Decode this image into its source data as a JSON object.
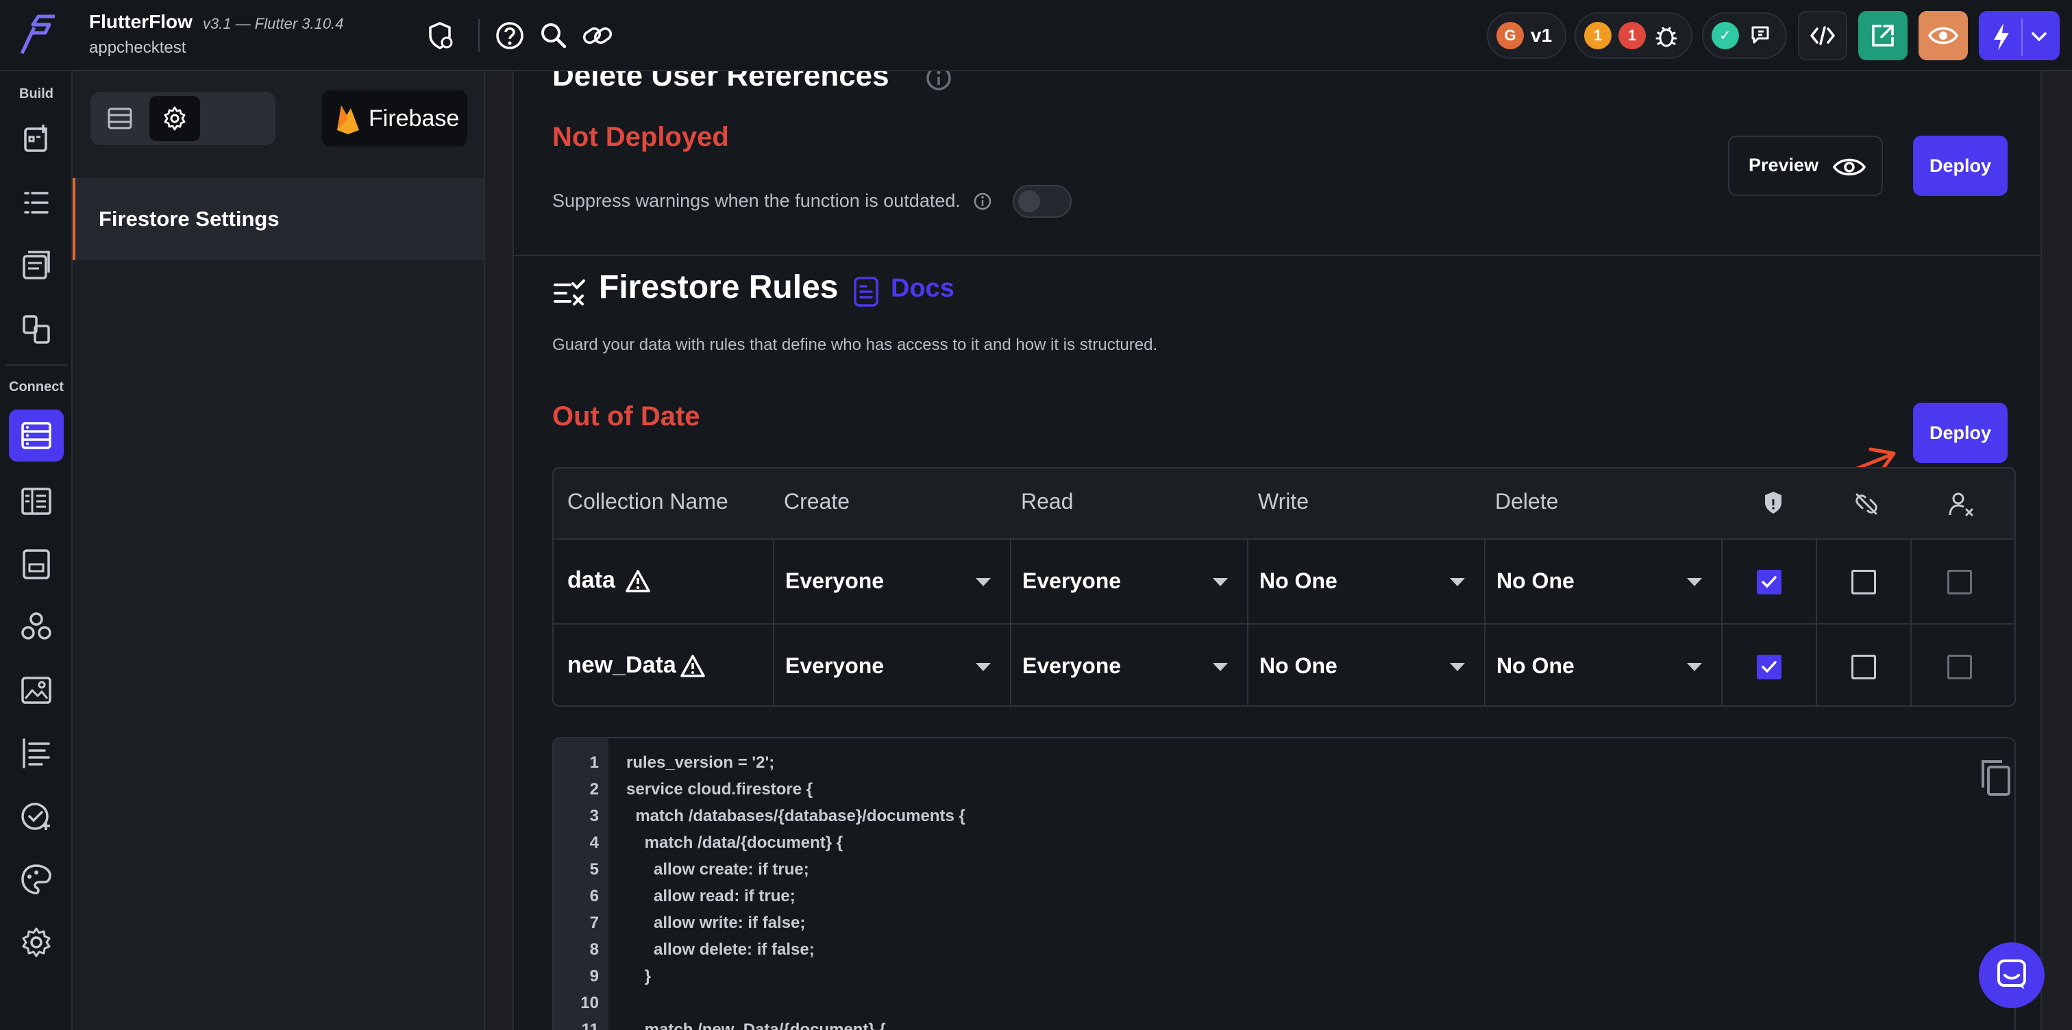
{
  "header": {
    "app_name": "FlutterFlow",
    "version": "v3.1 — Flutter 3.10.4",
    "project": "appchecktest",
    "branch_label": "v1",
    "warning_count": "1",
    "error_count": "1",
    "colors": {
      "brand": "#4b39ef",
      "warning": "#f29b22",
      "error": "#e0483e",
      "success": "#2fc9a4"
    }
  },
  "rail": {
    "build_label": "Build",
    "connect_label": "Connect"
  },
  "sidebar": {
    "firebase_label": "Firebase",
    "item": "Firestore Settings"
  },
  "main": {
    "old_heading": "Delete User References",
    "old_status": "Not Deployed",
    "preview_label": "Preview",
    "deploy_label": "Deploy",
    "suppress_text": "Suppress warnings when the function is outdated.",
    "rules_title": "Firestore Rules",
    "docs_label": "Docs",
    "rules_desc": "Guard your data with rules that define who has access to it and how it is structured.",
    "rules_status": "Out of Date"
  },
  "table": {
    "headers": [
      "Collection Name",
      "Create",
      "Read",
      "Write",
      "Delete"
    ],
    "rows": [
      {
        "name": "data",
        "create": "Everyone",
        "read": "Everyone",
        "write": "No One",
        "delete": "No One"
      },
      {
        "name": "new_Data",
        "create": "Everyone",
        "read": "Everyone",
        "write": "No One",
        "delete": "No One"
      }
    ]
  },
  "code": {
    "lines": [
      "rules_version = '2';",
      "service cloud.firestore {",
      "  match /databases/{database}/documents {",
      "    match /data/{document} {",
      "      allow create: if true;",
      "      allow read: if true;",
      "      allow write: if false;",
      "      allow delete: if false;",
      "    }",
      "",
      "    match /new_Data/{document} {"
    ]
  }
}
